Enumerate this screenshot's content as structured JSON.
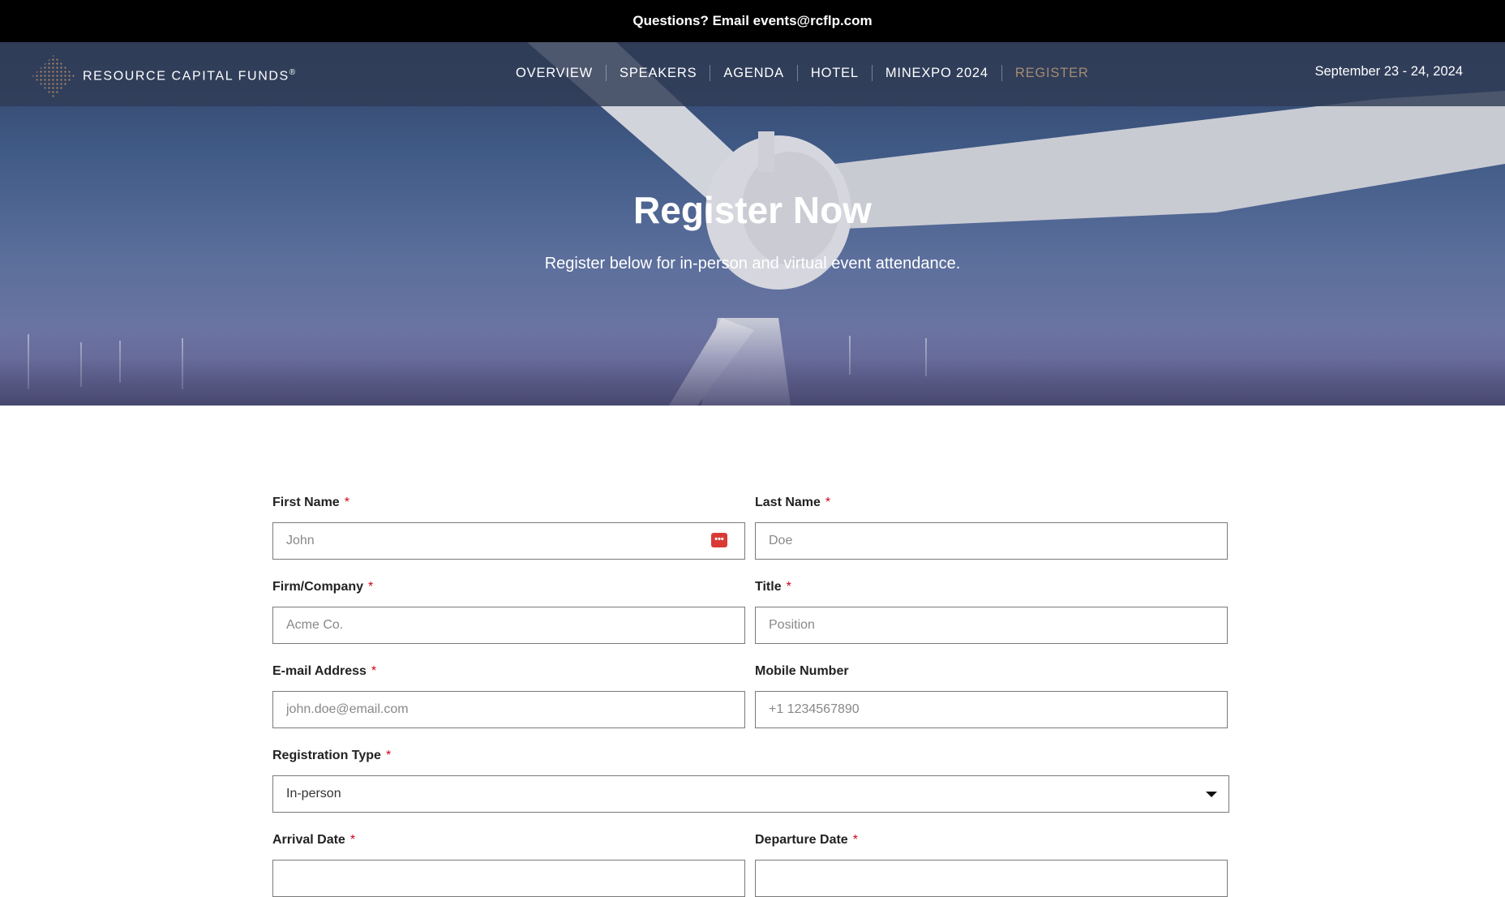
{
  "topbar": {
    "text": "Questions? Email events@rcflp.com"
  },
  "brand": {
    "name": "RESOURCE CAPITAL FUNDS",
    "mark": "®"
  },
  "nav": {
    "items": [
      {
        "label": "OVERVIEW"
      },
      {
        "label": "SPEAKERS"
      },
      {
        "label": "AGENDA"
      },
      {
        "label": "HOTEL"
      },
      {
        "label": "MINEXPO 2024"
      },
      {
        "label": "REGISTER",
        "active": true
      }
    ],
    "date": "September 23 - 24, 2024"
  },
  "hero": {
    "title": "Register Now",
    "subtitle": "Register below for in-person and virtual event attendance."
  },
  "form": {
    "first_name": {
      "label": "First Name",
      "placeholder": "John"
    },
    "last_name": {
      "label": "Last Name",
      "placeholder": "Doe"
    },
    "company": {
      "label": "Firm/Company",
      "placeholder": "Acme Co."
    },
    "title": {
      "label": "Title",
      "placeholder": "Position"
    },
    "email": {
      "label": "E-mail Address",
      "placeholder": "john.doe@email.com"
    },
    "mobile": {
      "label": "Mobile Number",
      "placeholder": "+1 1234567890"
    },
    "registration_type": {
      "label": "Registration Type",
      "value": "In-person"
    },
    "arrival_date": {
      "label": "Arrival Date"
    },
    "departure_date": {
      "label": "Departure Date"
    },
    "required_mark": "*"
  },
  "colors": {
    "accent_active_nav": "#a78a72",
    "required": "#d0021b"
  }
}
